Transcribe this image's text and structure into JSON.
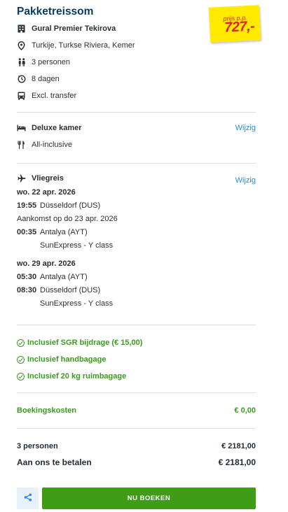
{
  "header": {
    "title": "Pakketreissom"
  },
  "price_sticker": {
    "label": "prijs p.p.",
    "price": "727,-"
  },
  "package": {
    "hotel": "Gural Premier Tekirova",
    "location": "Turkije, Turkse Riviera, Kemer",
    "persons": "3 personen",
    "duration": "8 dagen",
    "transfer": "Excl. transfer"
  },
  "room": {
    "type": "Deluxe kamer",
    "board": "All-inclusive",
    "change_label": "Wijzig"
  },
  "flight": {
    "heading": "Vliegreis",
    "change_label": "Wijzig",
    "outbound": {
      "date": "wo. 22 apr. 2026",
      "depart_time": "19:55",
      "depart_airport": "Düsseldorf (DUS)",
      "arrival_note": "Aankomst op do 23 apr. 2026",
      "arrive_time": "00:35",
      "arrive_airport": "Antalya (AYT)",
      "carrier": "SunExpress - Y class"
    },
    "return": {
      "date": "wo. 29 apr. 2026",
      "depart_time": "05:30",
      "depart_airport": "Antalya (AYT)",
      "arrive_time": "08:30",
      "arrive_airport": "Düsseldorf (DUS)",
      "carrier": "SunExpress - Y class"
    }
  },
  "inclusions": [
    "Inclusief SGR bijdrage (€ 15,00)",
    "Inclusief handbagage",
    "Inclusief 20 kg ruimbagage"
  ],
  "booking_costs": {
    "label": "Boekingskosten",
    "value": "€ 0,00"
  },
  "totals": {
    "persons_label": "3 personen",
    "persons_value": "€ 2181,00",
    "pay_label": "Aan ons te betalen",
    "pay_value": "€ 2181,00"
  },
  "actions": {
    "book_label": "NU BOEKEN"
  },
  "colors": {
    "title": "#0b3a5f",
    "link": "#2b8ad3",
    "green": "#3a9b1e",
    "book_button": "#3f9c16",
    "sticker": "#ffea00",
    "sticker_text": "#e2231a"
  }
}
